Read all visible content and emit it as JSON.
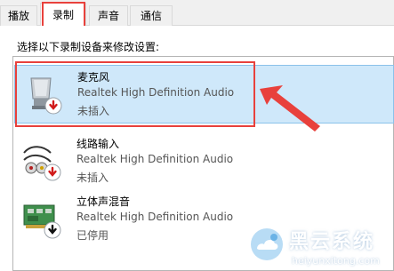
{
  "tabs": [
    {
      "label": "播放"
    },
    {
      "label": "录制"
    },
    {
      "label": "声音"
    },
    {
      "label": "通信"
    }
  ],
  "instruction": "选择以下录制设备来修改设置:",
  "devices": [
    {
      "name": "麦克风",
      "description": "Realtek High Definition Audio",
      "status": "未插入",
      "icon": "microphone-icon"
    },
    {
      "name": "线路输入",
      "description": "Realtek High Definition Audio",
      "status": "未插入",
      "icon": "line-in-icon"
    },
    {
      "name": "立体声混音",
      "description": "Realtek High Definition Audio",
      "status": "已停用",
      "icon": "stereo-mix-icon"
    }
  ],
  "watermark": {
    "title": "黑云系统",
    "url": "heiyunxitong.com"
  },
  "colors": {
    "highlight": "#e8413c",
    "selection": "#cfe8fa"
  }
}
